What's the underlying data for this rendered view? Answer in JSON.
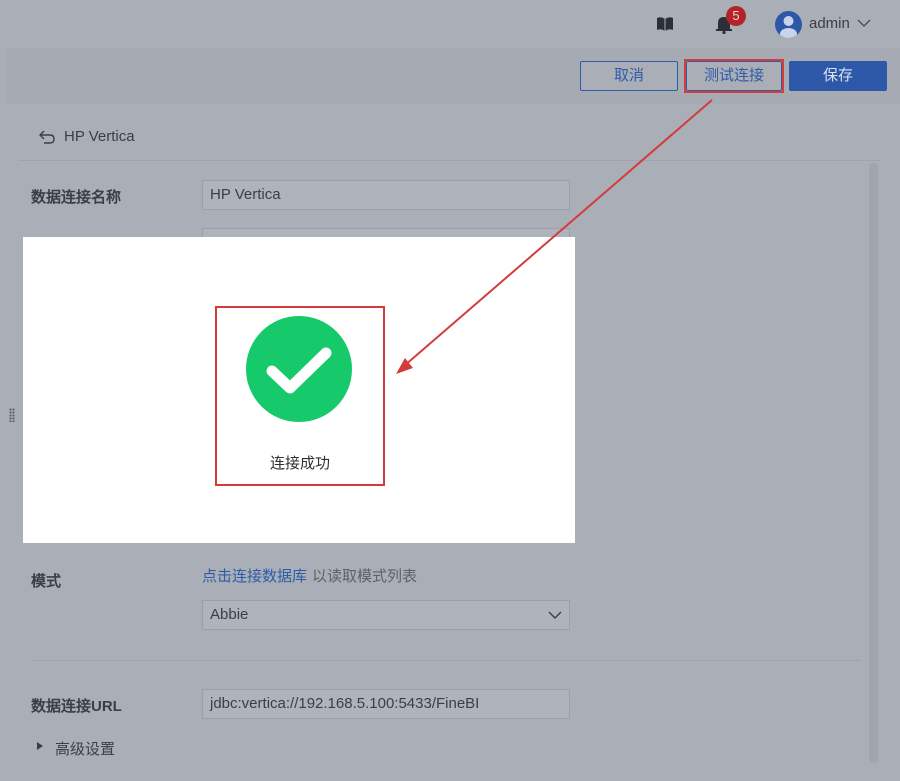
{
  "header": {
    "notification_count": "5",
    "user": "admin"
  },
  "toolbar": {
    "cancel_label": "取消",
    "test_label": "测试连接",
    "save_label": "保存"
  },
  "breadcrumb": {
    "title": "HP Vertica"
  },
  "form": {
    "name_label": "数据连接名称",
    "name_value": "HP Vertica",
    "schema_label": "模式",
    "schema_link": "点击连接数据库",
    "schema_hint": "以读取模式列表",
    "schema_value": "Abbie",
    "url_label": "数据连接URL",
    "url_value": "jdbc:vertica://192.168.5.100:5433/FineBI",
    "advanced_label": "高级设置"
  },
  "dialog": {
    "message": "连接成功",
    "icon": "check-circle-icon",
    "icon_color": "#16c96a"
  },
  "colors": {
    "accent": "#2d58a8",
    "highlight": "#d43c3c"
  }
}
